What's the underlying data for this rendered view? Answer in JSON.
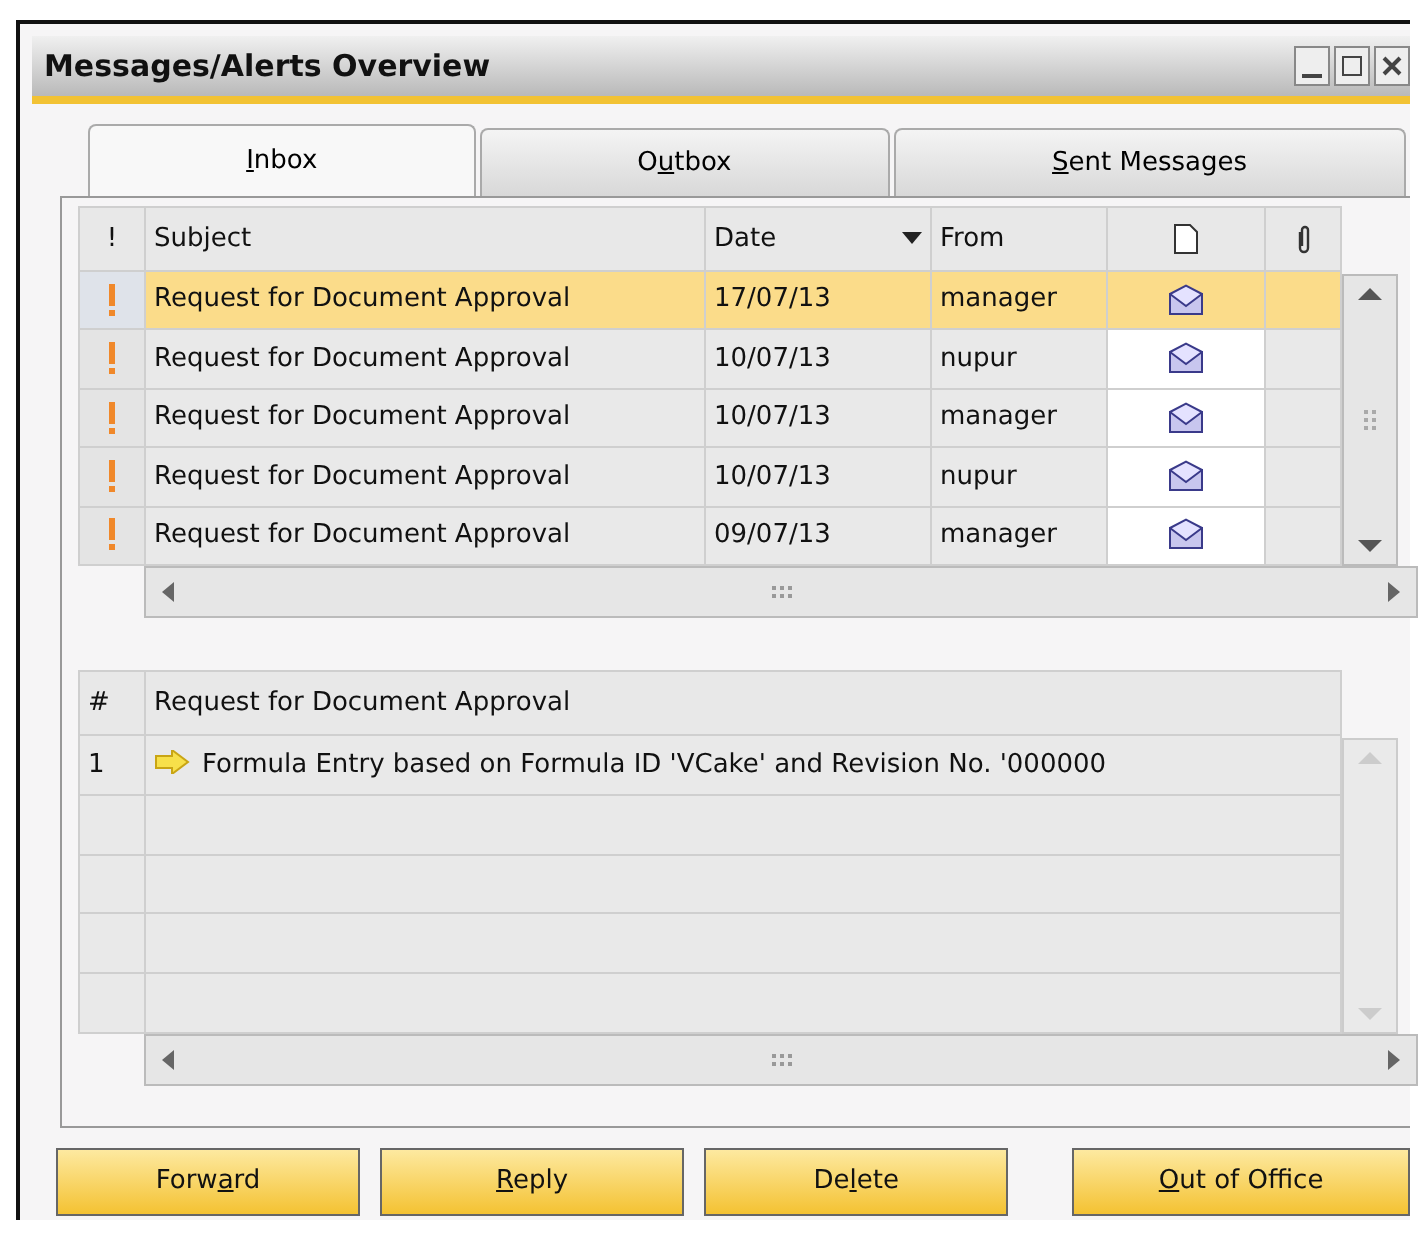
{
  "window": {
    "title": "Messages/Alerts Overview"
  },
  "tabs": [
    {
      "key": "I",
      "after": "nbox",
      "selected": true
    },
    {
      "before": "O",
      "key": "u",
      "after": "tbox",
      "selected": false
    },
    {
      "key": "S",
      "after": "ent Messages",
      "selected": false
    }
  ],
  "messages": {
    "columns": [
      "!",
      "Subject",
      "Date",
      "From"
    ],
    "rows": [
      {
        "subject": "Request for Document Approval",
        "date": "17/07/13",
        "from": "manager",
        "high_priority": true,
        "selected": true
      },
      {
        "subject": "Request for Document Approval",
        "date": "10/07/13",
        "from": "nupur",
        "high_priority": true,
        "selected": false
      },
      {
        "subject": "Request for Document Approval",
        "date": "10/07/13",
        "from": "manager",
        "high_priority": true,
        "selected": false
      },
      {
        "subject": "Request for Document Approval",
        "date": "10/07/13",
        "from": "nupur",
        "high_priority": true,
        "selected": false
      },
      {
        "subject": "Request for Document Approval",
        "date": "09/07/13",
        "from": "manager",
        "high_priority": true,
        "selected": false
      }
    ]
  },
  "details": {
    "columns": [
      "#",
      "Request for Document Approval"
    ],
    "rows": [
      {
        "number": "1",
        "text": "Formula Entry based on Formula ID 'VCake' and Revision No. '000000"
      }
    ]
  },
  "buttons": [
    {
      "before": "Forw",
      "key": "a",
      "after": "rd"
    },
    {
      "key": "R",
      "after": "eply"
    },
    {
      "before": "De",
      "key": "l",
      "after": "ete"
    },
    {
      "key": "O",
      "after": "ut of Office"
    }
  ]
}
